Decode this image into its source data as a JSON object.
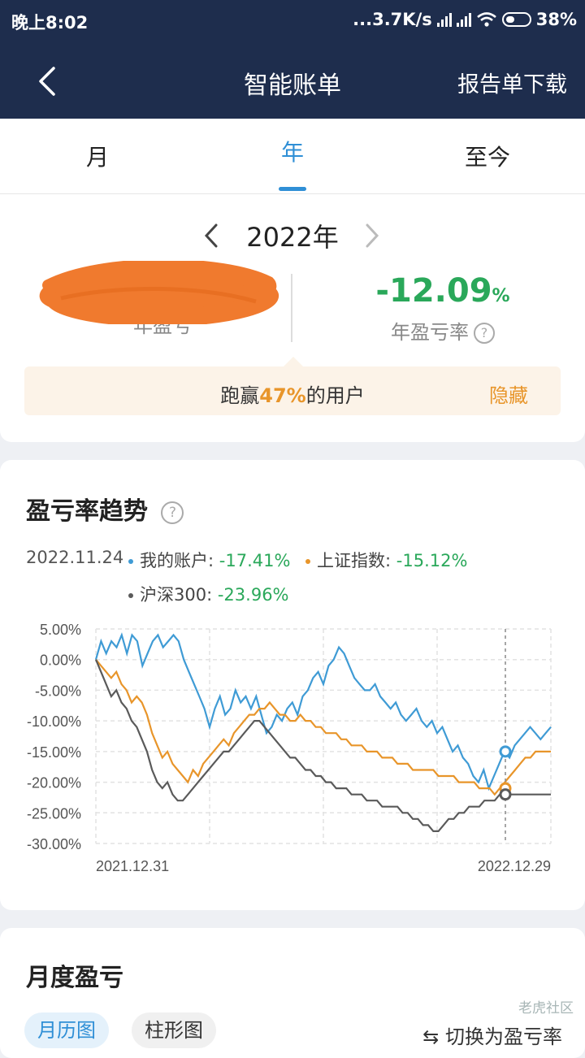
{
  "status_bar": {
    "time": "晚上8:02",
    "network": "...3.7K/s",
    "battery": "38%",
    "battery_level": 0.38
  },
  "nav": {
    "back_icon": "chevron-left-icon",
    "title": "智能账单",
    "download_label": "报告单下载"
  },
  "tabs": [
    {
      "label": "月",
      "active": false
    },
    {
      "label": "年",
      "active": true
    },
    {
      "label": "至今",
      "active": false
    }
  ],
  "summary": {
    "year_label": "2022年",
    "pl_label": "年盈亏",
    "pl_value_redacted": true,
    "rate_value": "-12.09",
    "rate_unit": "%",
    "rate_label": "年盈亏率",
    "beat_prefix": "跑赢",
    "beat_percent": "47%",
    "beat_suffix": "的用户",
    "hide_label": "隐藏"
  },
  "trend": {
    "title": "盈亏率趋势",
    "date": "2022.11.24",
    "legend": [
      {
        "name": "我的账户:",
        "value": "-17.41%",
        "color": "#3f9bd5"
      },
      {
        "name": "上证指数:",
        "value": "-15.12%",
        "color": "#e8952a"
      },
      {
        "name": "沪深300:",
        "value": "-23.96%",
        "color": "#5a5a5a"
      }
    ]
  },
  "chart_data": {
    "type": "line",
    "x_start_label": "2021.12.31",
    "x_end_label": "2022.12.29",
    "y_ticks": [
      "5.00%",
      "0.00%",
      "-5.00%",
      "-10.00%",
      "-15.00%",
      "-20.00%",
      "-25.00%",
      "-30.00%"
    ],
    "ylim": [
      -30,
      5
    ],
    "grid": true,
    "cursor_x": 0.9,
    "series": [
      {
        "name": "我的账户",
        "color": "#3f9bd5",
        "values": [
          0,
          3,
          1,
          3,
          2,
          4,
          1,
          4,
          3,
          -1,
          1,
          3,
          4,
          2,
          3,
          4,
          3,
          0,
          -2,
          -4,
          -6,
          -8,
          -11,
          -8,
          -6,
          -9,
          -8,
          -5,
          -7,
          -6,
          -8,
          -6,
          -9,
          -12,
          -11,
          -9,
          -10,
          -8,
          -7,
          -9,
          -6,
          -5,
          -3,
          -2,
          -4,
          -1,
          0,
          2,
          1,
          -1,
          -3,
          -4,
          -5,
          -5,
          -4,
          -6,
          -7,
          -8,
          -7,
          -9,
          -10,
          -9,
          -8,
          -10,
          -11,
          -10,
          -12,
          -11,
          -13,
          -15,
          -14,
          -16,
          -17,
          -19,
          -20,
          -18,
          -21,
          -19,
          -17,
          -15,
          -16,
          -14,
          -13,
          -12,
          -11,
          -12,
          -13,
          -12,
          -11
        ]
      },
      {
        "name": "上证指数",
        "color": "#e8952a",
        "values": [
          0,
          -1,
          -2,
          -3,
          -2,
          -4,
          -5,
          -7,
          -6,
          -7,
          -9,
          -12,
          -14,
          -16,
          -15,
          -17,
          -18,
          -19,
          -20,
          -18,
          -19,
          -17,
          -16,
          -15,
          -14,
          -13,
          -14,
          -12,
          -11,
          -10,
          -9,
          -9,
          -8,
          -8,
          -7,
          -8,
          -9,
          -9,
          -10,
          -10,
          -9,
          -10,
          -10,
          -11,
          -11,
          -12,
          -12,
          -12,
          -13,
          -13,
          -14,
          -14,
          -14,
          -15,
          -15,
          -15,
          -16,
          -16,
          -16,
          -17,
          -17,
          -17,
          -18,
          -18,
          -18,
          -18,
          -18,
          -19,
          -19,
          -19,
          -19,
          -20,
          -20,
          -20,
          -20,
          -21,
          -21,
          -21,
          -22,
          -21,
          -20,
          -19,
          -18,
          -17,
          -16,
          -16,
          -15,
          -15,
          -15,
          -15
        ]
      },
      {
        "name": "沪深300",
        "color": "#5a5a5a",
        "values": [
          0,
          -2,
          -4,
          -6,
          -5,
          -7,
          -8,
          -10,
          -11,
          -13,
          -15,
          -18,
          -20,
          -21,
          -20,
          -22,
          -23,
          -23,
          -22,
          -21,
          -20,
          -19,
          -18,
          -17,
          -16,
          -15,
          -15,
          -14,
          -13,
          -12,
          -11,
          -10,
          -10,
          -11,
          -12,
          -13,
          -14,
          -15,
          -16,
          -16,
          -17,
          -18,
          -18,
          -19,
          -19,
          -20,
          -20,
          -21,
          -21,
          -21,
          -22,
          -22,
          -22,
          -23,
          -23,
          -23,
          -24,
          -24,
          -24,
          -24,
          -25,
          -25,
          -26,
          -26,
          -27,
          -27,
          -28,
          -28,
          -27,
          -26,
          -26,
          -25,
          -25,
          -24,
          -24,
          -24,
          -23,
          -23,
          -23,
          -22,
          -22,
          -22,
          -22,
          -22,
          -22,
          -22,
          -22,
          -22,
          -22,
          -22
        ]
      }
    ]
  },
  "monthly": {
    "title": "月度盈亏",
    "chip_calendar": "月历图",
    "chip_bar": "柱形图",
    "switch_label": "切换为盈亏率",
    "switch_icon": "swap-icon"
  },
  "watermark": "老虎社区"
}
